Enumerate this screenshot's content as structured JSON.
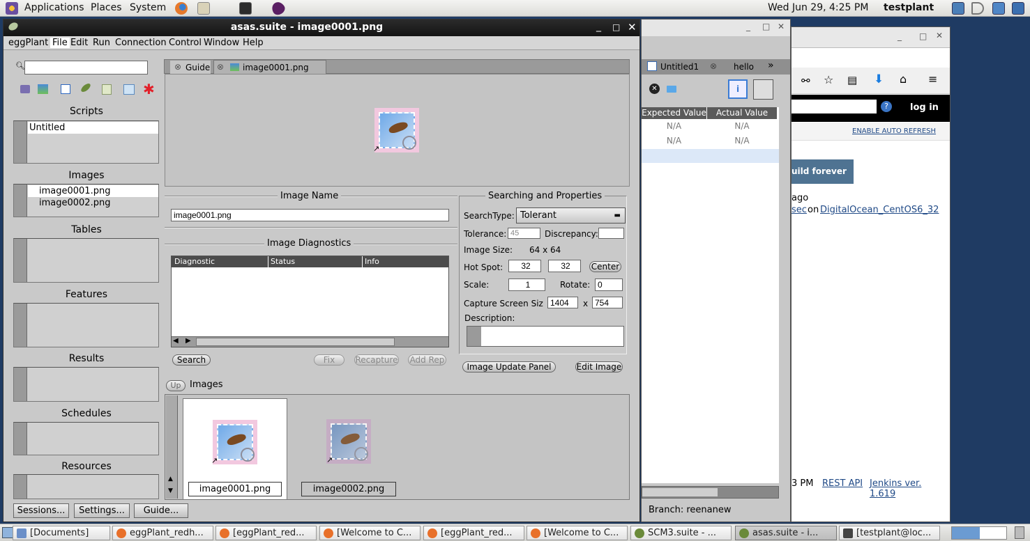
{
  "top_panel": {
    "menus": [
      "Applications",
      "Places",
      "System"
    ],
    "datetime": "Wed Jun 29,  4:25 PM",
    "user": "testplant"
  },
  "eggplant": {
    "title": "asas.suite - image0001.png",
    "menu": [
      "eggPlant",
      "File",
      "Edit",
      "Run",
      "Connection",
      "Control",
      "Window",
      "Help"
    ],
    "search_value": "",
    "sections": {
      "scripts": "Scripts",
      "images": "Images",
      "tables": "Tables",
      "features": "Features",
      "results": "Results",
      "schedules": "Schedules",
      "resources": "Resources"
    },
    "scripts": [
      "Untitled"
    ],
    "images": [
      "image0001.png",
      "image0002.png"
    ],
    "tabs": [
      "Guide",
      "image0001.png"
    ],
    "image_name_label": "Image Name",
    "image_name_value": "image0001.png",
    "diagnostics_label": "Image Diagnostics",
    "diag_columns": [
      "Diagnostic",
      "Status",
      "Info"
    ],
    "searching_label": "Searching and Properties",
    "search_type_label": "SearchType:",
    "search_type_value": "Tolerant",
    "tolerance_label": "Tolerance:",
    "tolerance_value": "45",
    "discrepancy_label": "Discrepancy:",
    "discrepancy_value": "",
    "image_size_label": "Image Size:",
    "image_size_value": "64 x 64",
    "hotspot_label": "Hot Spot:",
    "hotspot_x": "32",
    "hotspot_y": "32",
    "center_label": "Center",
    "scale_label": "Scale:",
    "scale_value": "1",
    "rotate_label": "Rotate:",
    "rotate_value": "0",
    "capture_label": "Capture Screen Siz",
    "capture_w": "1404",
    "capture_x": "x",
    "capture_h": "754",
    "description_label": "Description:",
    "buttons": {
      "search": "Search",
      "fix": "Fix",
      "recapture": "Recapture",
      "add_rep": "Add Rep",
      "image_update": "Image Update Panel",
      "edit_image": "Edit Image",
      "up": "Up"
    },
    "images_header": "Images",
    "thumbs": [
      "image0001.png",
      "image0002.png"
    ],
    "bottom_buttons": [
      "Sessions...",
      "Settings...",
      "Guide..."
    ]
  },
  "middle_window": {
    "tabs": [
      "Untitled1",
      "hello"
    ],
    "columns": [
      "Expected Value",
      "Actual Value"
    ],
    "rows": [
      [
        "N/A",
        "N/A"
      ],
      [
        "N/A",
        "N/A"
      ]
    ],
    "branch": "Branch: reenanew"
  },
  "jenkins": {
    "login": "log in",
    "auto_refresh": "ENABLE AUTO REFRESH",
    "build_forever": "uild forever",
    "ago": "ago",
    "sec": "sec",
    "on": "on",
    "node": "DigitalOcean_CentOS6_32",
    "time": "3 PM",
    "rest_api": "REST API",
    "version": "Jenkins ver. 1.619"
  },
  "taskbar": [
    "[Documents]",
    "eggPlant_redh...",
    "[eggPlant_red...",
    "[Welcome to C...",
    "[eggPlant_red...",
    "[Welcome to C...",
    "SCM3.suite - ...",
    "asas.suite - i...",
    "[testplant@loc..."
  ]
}
